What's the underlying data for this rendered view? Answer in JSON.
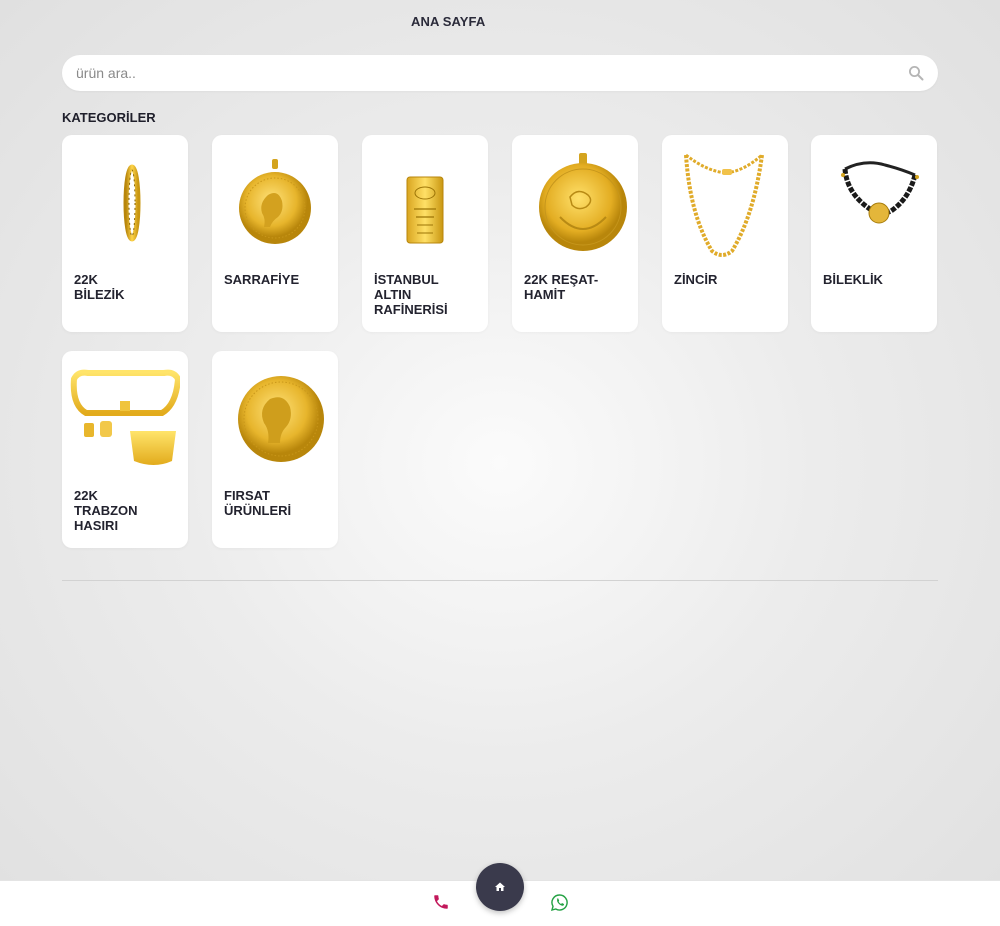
{
  "header": {
    "title": "ANA SAYFA"
  },
  "search": {
    "placeholder": "ürün ara..",
    "value": ""
  },
  "categories_title": "KATEGORİLER",
  "categories": [
    {
      "label": "22K\nBİLEZİK",
      "image": "bangle"
    },
    {
      "label": "SARRAFİYE",
      "image": "ataturk-coin-pendant"
    },
    {
      "label": "İSTANBUL\nALTIN\nRAFİNERİSİ",
      "image": "gold-bar"
    },
    {
      "label": "22K REŞAT-\nHAMİT",
      "image": "resat-coin"
    },
    {
      "label": "ZİNCİR",
      "image": "chain"
    },
    {
      "label": "BİLEKLİK",
      "image": "bracelet"
    },
    {
      "label": "22K\nTRABZON\nHASIRI",
      "image": "trabzon-set"
    },
    {
      "label": "FIRSAT\nÜRÜNLERİ",
      "image": "ataturk-coin"
    }
  ],
  "bottom_nav": {
    "phone": "phone-icon",
    "home": "home-icon",
    "whatsapp": "whatsapp-icon",
    "colors": {
      "phone": "#c2185b",
      "whatsapp": "#25a244",
      "home_bg": "#3a3a4c"
    }
  }
}
